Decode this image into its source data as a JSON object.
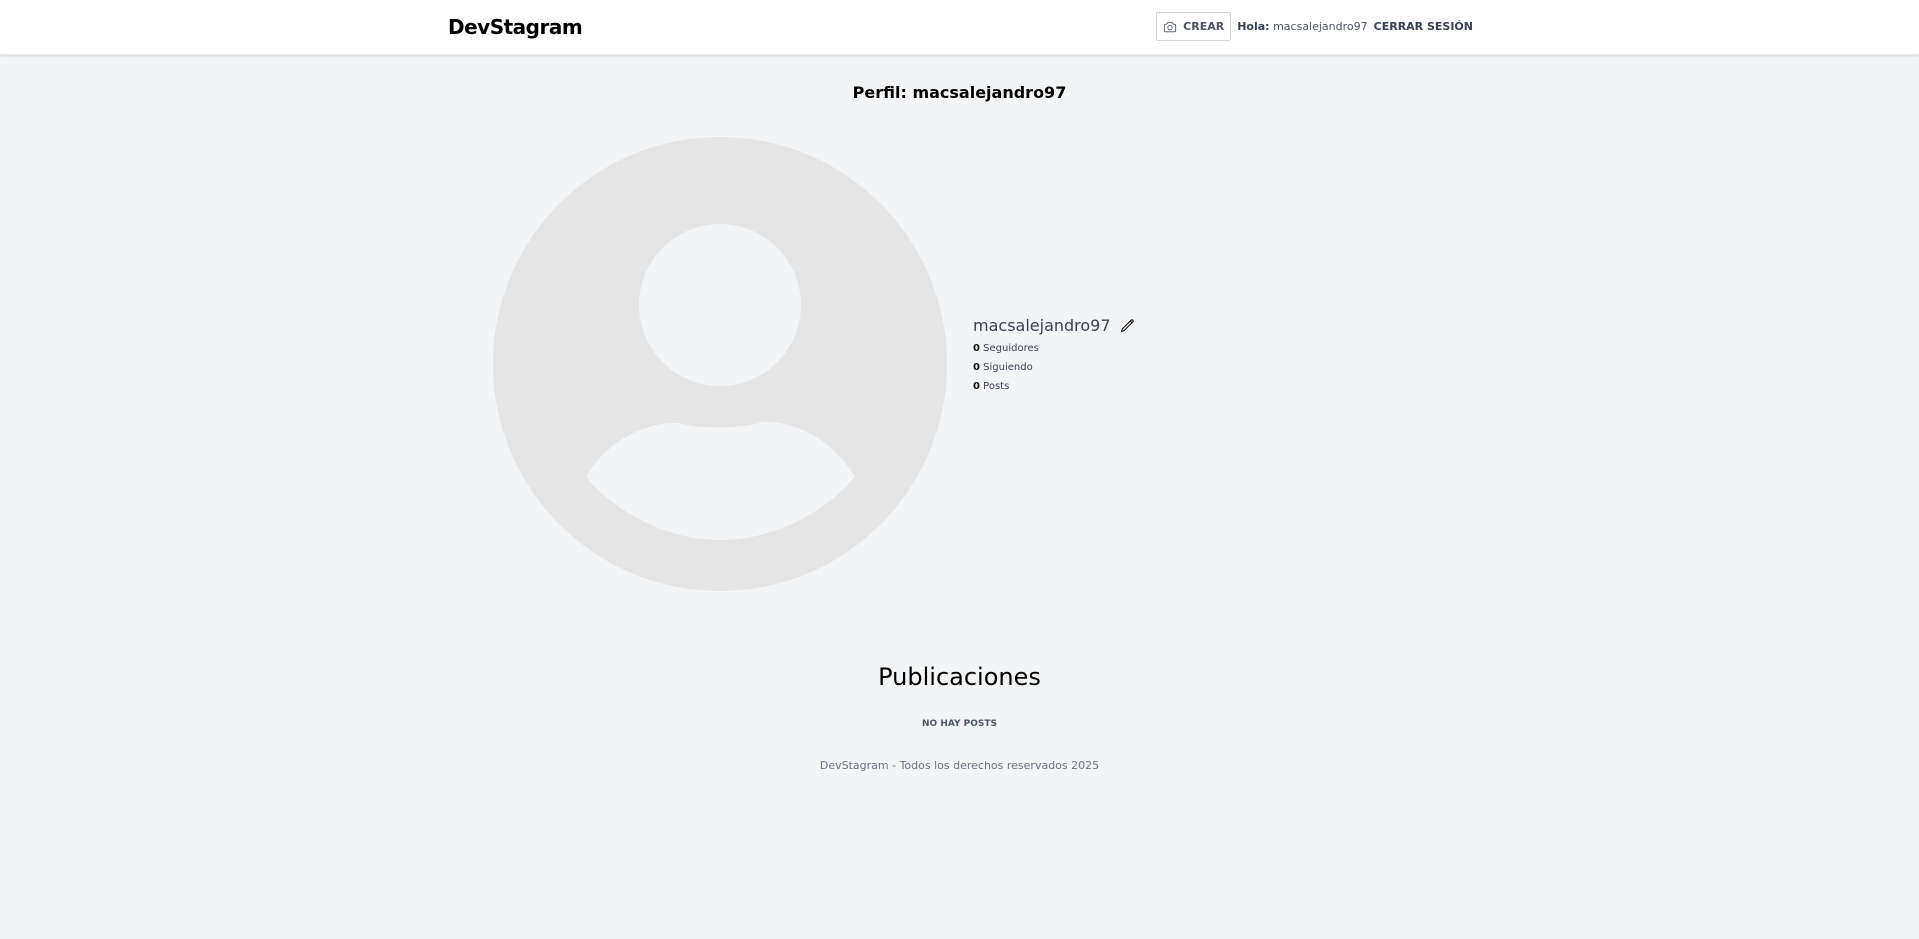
{
  "header": {
    "logo": "DevStagram",
    "create_label": "CREAR",
    "greeting_prefix": "Hola:",
    "greeting_user": "macsalejandro97",
    "logout_label": "CERRAR SESIÓN"
  },
  "profile": {
    "title": "Perfil: macsalejandro97",
    "username": "macsalejandro97",
    "followers_count": "0",
    "followers_label": "Seguidores",
    "following_count": "0",
    "following_label": "Siguiendo",
    "posts_count": "0",
    "posts_label": "Posts"
  },
  "publications": {
    "title": "Publicaciones",
    "empty_message": "NO HAY POSTS"
  },
  "footer": {
    "text": "DevStagram - Todos los derechos reservados 2025"
  },
  "icons": {
    "create": "camera-icon",
    "edit": "pencil-icon",
    "avatar": "user-avatar-placeholder"
  },
  "colors": {
    "background": "#f3f4f6",
    "header_bg": "#ffffff",
    "avatar_bg": "#e5e5e5",
    "avatar_figure": "#f3f4f6"
  }
}
